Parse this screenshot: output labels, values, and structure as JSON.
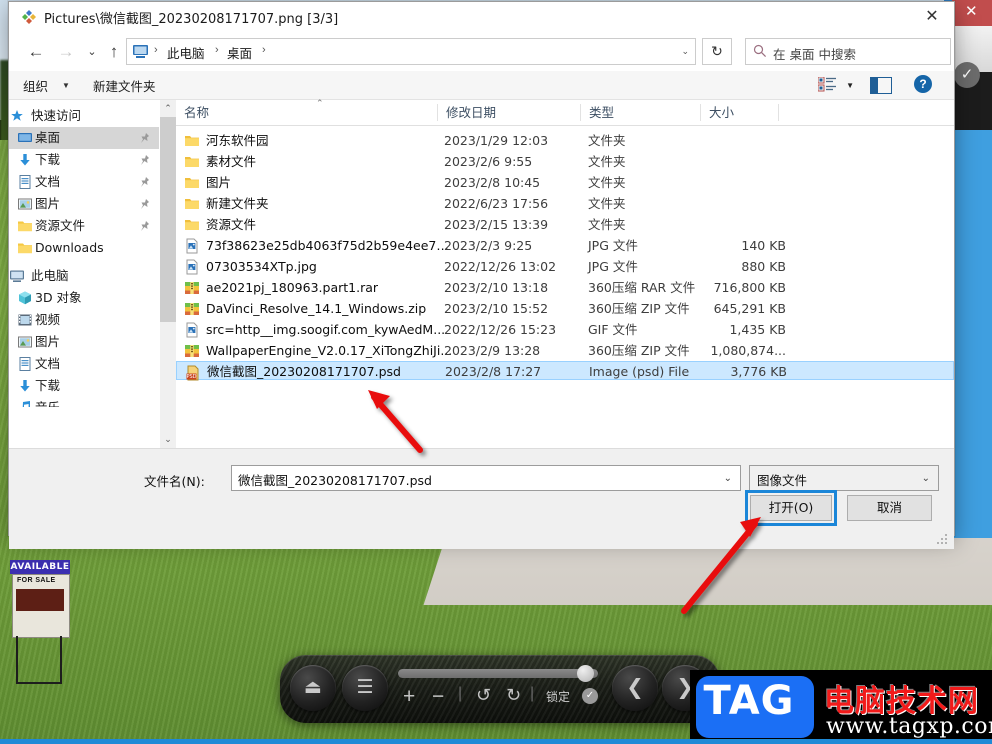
{
  "window": {
    "title": "Pictures\\微信截图_20230208171707.png [3/3]",
    "title_icon": "photoshop-diamond-icon",
    "close_label": "✕"
  },
  "nav": {
    "back": "←",
    "forward": "→",
    "recent": "⌄",
    "up": "↑",
    "breadcrumb": [
      "此电脑",
      "桌面"
    ],
    "breadcrumb_separator": "›",
    "refresh": "↻",
    "search": {
      "placeholder": "在 桌面 中搜索",
      "icon": "search-icon"
    }
  },
  "command_bar": {
    "organize": "组织",
    "new_folder": "新建文件夹",
    "view_icon": "list-view-icon",
    "pane_icon": "preview-pane-icon",
    "help_icon": "help-icon",
    "help_glyph": "?"
  },
  "nav_pane": {
    "groups": [
      {
        "label": "快速访问",
        "icon": "star-pin-icon",
        "items": [
          {
            "label": "桌面",
            "icon": "desktop-icon",
            "pinned": true,
            "selected": true
          },
          {
            "label": "下载",
            "icon": "download-icon",
            "pinned": true,
            "selected": false
          },
          {
            "label": "文档",
            "icon": "document-icon",
            "pinned": true,
            "selected": false
          },
          {
            "label": "图片",
            "icon": "pictures-icon",
            "pinned": true,
            "selected": false
          },
          {
            "label": "资源文件",
            "icon": "folder-icon",
            "pinned": true,
            "selected": false
          },
          {
            "label": "Downloads",
            "icon": "folder-icon",
            "pinned": false,
            "selected": false
          }
        ]
      },
      {
        "label": "此电脑",
        "icon": "this-pc-icon",
        "items": [
          {
            "label": "3D 对象",
            "icon": "3d-objects-icon",
            "pinned": false,
            "selected": false
          },
          {
            "label": "视频",
            "icon": "videos-icon",
            "pinned": false,
            "selected": false
          },
          {
            "label": "图片",
            "icon": "pictures-icon",
            "pinned": false,
            "selected": false
          },
          {
            "label": "文档",
            "icon": "document-icon",
            "pinned": false,
            "selected": false
          },
          {
            "label": "下载",
            "icon": "download-icon",
            "pinned": false,
            "selected": false
          },
          {
            "label": "音乐",
            "icon": "music-icon",
            "pinned": false,
            "selected": false
          }
        ]
      }
    ],
    "scroll_up": "⌃",
    "scroll_down": "⌄"
  },
  "file_list": {
    "columns": [
      {
        "key": "name",
        "label": "名称"
      },
      {
        "key": "date",
        "label": "修改日期"
      },
      {
        "key": "type",
        "label": "类型"
      },
      {
        "key": "size",
        "label": "大小"
      }
    ],
    "sort_indicator": "⌃",
    "rows": [
      {
        "name": "河东软件园",
        "date": "2023/1/29 12:03",
        "type": "文件夹",
        "size": "",
        "icon": "folder-icon",
        "selected": false
      },
      {
        "name": "素材文件",
        "date": "2023/2/6 9:55",
        "type": "文件夹",
        "size": "",
        "icon": "folder-icon",
        "selected": false
      },
      {
        "name": "图片",
        "date": "2023/2/8 10:45",
        "type": "文件夹",
        "size": "",
        "icon": "folder-icon",
        "selected": false
      },
      {
        "name": "新建文件夹",
        "date": "2022/6/23 17:56",
        "type": "文件夹",
        "size": "",
        "icon": "folder-icon",
        "selected": false
      },
      {
        "name": "资源文件",
        "date": "2023/2/15 13:39",
        "type": "文件夹",
        "size": "",
        "icon": "folder-icon",
        "selected": false
      },
      {
        "name": "73f38623e25db4063f75d2b59e4ee79...",
        "date": "2023/2/3 9:25",
        "type": "JPG 文件",
        "size": "140 KB",
        "icon": "image-file-icon",
        "selected": false
      },
      {
        "name": "07303534XTp.jpg",
        "date": "2022/12/26 13:02",
        "type": "JPG 文件",
        "size": "880 KB",
        "icon": "image-file-icon",
        "selected": false
      },
      {
        "name": "ae2021pj_180963.part1.rar",
        "date": "2023/2/10 13:18",
        "type": "360压缩 RAR 文件",
        "size": "716,800 KB",
        "icon": "archive-file-icon",
        "selected": false
      },
      {
        "name": "DaVinci_Resolve_14.1_Windows.zip",
        "date": "2023/2/10 15:52",
        "type": "360压缩 ZIP 文件",
        "size": "645,291 KB",
        "icon": "archive-file-icon",
        "selected": false
      },
      {
        "name": "src=http__img.soogif.com_kywAedM...",
        "date": "2022/12/26 15:23",
        "type": "GIF 文件",
        "size": "1,435 KB",
        "icon": "image-file-icon",
        "selected": false
      },
      {
        "name": "WallpaperEngine_V2.0.17_XiTongZhiJi...",
        "date": "2023/2/9 13:28",
        "type": "360压缩 ZIP 文件",
        "size": "1,080,874...",
        "icon": "archive-file-icon",
        "selected": false
      },
      {
        "name": "微信截图_20230208171707.psd",
        "date": "2023/2/8 17:27",
        "type": "Image (psd) File",
        "size": "3,776 KB",
        "icon": "psd-file-icon",
        "selected": true
      }
    ]
  },
  "footer": {
    "filename_label": "文件名(N):",
    "filename_value": "微信截图_20230208171707.psd",
    "filetype_value": "图像文件",
    "open_button": "打开(O)",
    "cancel_button": "取消",
    "dropdown_glyph": "⌄"
  },
  "annotations": {
    "arrow_to_file": "red-arrow-pointing-to-selected-file",
    "arrow_to_open": "red-arrow-pointing-to-open-button",
    "open_highlight_color": "#1b86d8"
  },
  "background_app": {
    "close_glyph": "✕",
    "close_color": "#c14d4d",
    "check_glyph": "✓"
  },
  "desktop": {
    "sign_top": "AVAILABLE",
    "sign_sub": "FOR SALE"
  },
  "media_toolbar": {
    "eject": "⏏",
    "menu": "☰",
    "zoom_in": "+",
    "zoom_out": "−",
    "undo": "↺",
    "redo": "↻",
    "separator": "|",
    "lock_label": "锁定",
    "lock_check": "✓",
    "prev": "❮",
    "next": "❯"
  },
  "watermark": {
    "tag": "TAG",
    "site_cn": "电脑技术网",
    "url": "www.tagxp.com",
    "tag_bg": "#1b6ff5",
    "cn_color": "#f21a1a"
  }
}
